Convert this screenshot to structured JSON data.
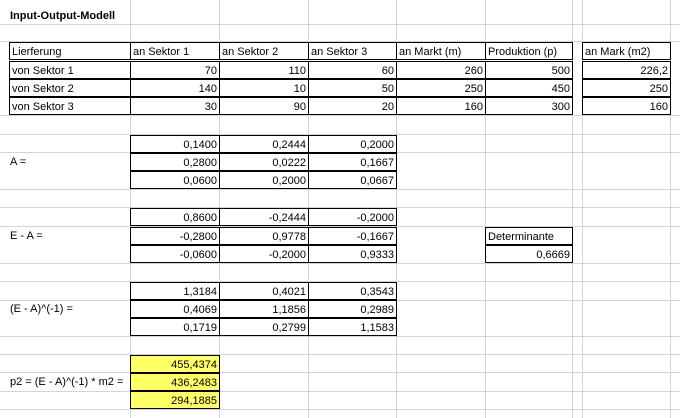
{
  "title": "Input-Output-Modell",
  "header": [
    "Lierferung",
    "an Sektor 1",
    "an Sektor 2",
    "an Sektor 3",
    "an Markt (m)",
    "Produktion (p)",
    "an Mark (m2)"
  ],
  "rows": [
    {
      "label": "von Sektor 1",
      "s1": "70",
      "s2": "110",
      "s3": "60",
      "m": "260",
      "p": "500",
      "m2": "226,2"
    },
    {
      "label": "von Sektor 2",
      "s1": "140",
      "s2": "10",
      "s3": "50",
      "m": "250",
      "p": "450",
      "m2": "250"
    },
    {
      "label": "von Sektor 3",
      "s1": "30",
      "s2": "90",
      "s3": "20",
      "m": "160",
      "p": "300",
      "m2": "160"
    }
  ],
  "matrix_a": {
    "label": "A =",
    "values": [
      [
        "0,1400",
        "0,2444",
        "0,2000"
      ],
      [
        "0,2800",
        "0,0222",
        "0,1667"
      ],
      [
        "0,0600",
        "0,2000",
        "0,0667"
      ]
    ]
  },
  "matrix_ea": {
    "label": "E - A =",
    "values": [
      [
        "0,8600",
        "-0,2444",
        "-0,2000"
      ],
      [
        "-0,2800",
        "0,9778",
        "-0,1667"
      ],
      [
        "-0,0600",
        "-0,2000",
        "0,9333"
      ]
    ]
  },
  "determinant": {
    "label": "Determinante",
    "value": "0,6669"
  },
  "matrix_inv": {
    "label": "(E - A)^(-1) =",
    "values": [
      [
        "1,3184",
        "0,4021",
        "0,3543"
      ],
      [
        "0,4069",
        "1,1856",
        "0,2989"
      ],
      [
        "0,1719",
        "0,2799",
        "1,1583"
      ]
    ]
  },
  "p2": {
    "label": "p2 = (E - A)^(-1) * m2 =",
    "values": [
      "455,4374",
      "436,2483",
      "294,1885"
    ]
  },
  "colors": {
    "highlight": "#ffff66",
    "gridline": "#d4d4d4",
    "border": "#000000"
  }
}
